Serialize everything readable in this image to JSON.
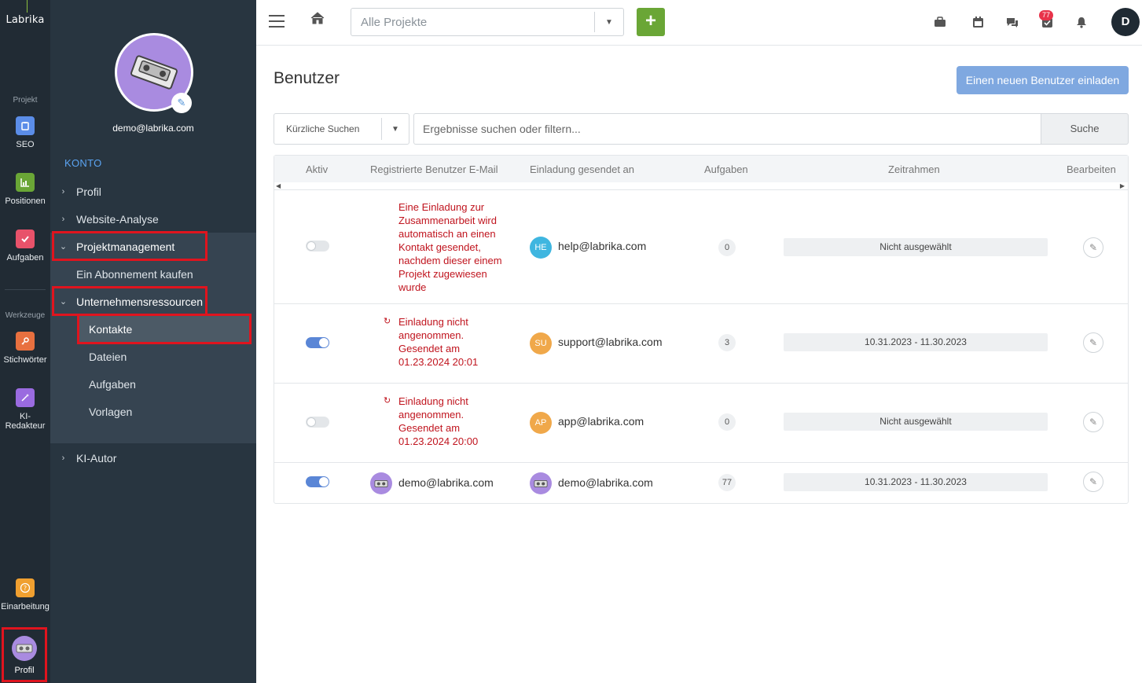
{
  "rail": {
    "logo": "Labrika",
    "section_project": "Projekt",
    "section_tools": "Werkzeuge",
    "items": [
      {
        "label": "SEO",
        "icon": "clipboard-icon",
        "color": "#5b8de8"
      },
      {
        "label": "Positionen",
        "icon": "chart-icon",
        "color": "#6aa636"
      },
      {
        "label": "Aufgaben",
        "icon": "check-icon",
        "color": "#e8526a"
      },
      {
        "label": "Stichwörter",
        "icon": "key-icon",
        "color": "#e8703f"
      },
      {
        "label1": "KI-",
        "label2": "Redakteur",
        "icon": "magic-wand-icon",
        "color": "#9a6be0"
      },
      {
        "label": "Einarbeitung",
        "icon": "help-icon",
        "color": "#f0a030"
      }
    ],
    "profile_label": "Profil"
  },
  "sidebar": {
    "email": "demo@labrika.com",
    "section": "KONTO",
    "nav": {
      "profil": "Profil",
      "website_analyse": "Website-Analyse",
      "projektmanagement": "Projektmanagement",
      "abonnement": "Ein Abonnement kaufen",
      "unternehmensressourcen": "Unternehmensressourcen",
      "kontakte": "Kontakte",
      "dateien": "Dateien",
      "aufgaben": "Aufgaben",
      "vorlagen": "Vorlagen",
      "ki_autor": "KI-Autor"
    }
  },
  "topbar": {
    "project_select": "Alle Projekte",
    "plus": "+",
    "badge_count": "77",
    "user_initial": "D"
  },
  "main": {
    "title": "Benutzer",
    "invite_button": "Einen neuen Benutzer einladen",
    "recent_searches": "Kürzliche Suchen",
    "search_placeholder": "Ergebnisse suchen oder filtern...",
    "search_button": "Suche",
    "columns": [
      "Aktiv",
      "Registrierte Benutzer E-Mail",
      "Einladung gesendet an",
      "Aufgaben",
      "Zeitrahmen",
      "Bearbeiten"
    ],
    "rows": [
      {
        "active": false,
        "registered_lines": [
          "Eine Einladung zur",
          "Zusammenarbeit wird",
          "automatisch an einen",
          "Kontakt gesendet,",
          "nachdem dieser einem",
          "Projekt zugewiesen",
          "wurde"
        ],
        "invite_initials": "HE",
        "invite_color": "#3fb6e0",
        "invite_email": "help@labrika.com",
        "tasks": "0",
        "period": "Nicht ausgewählt"
      },
      {
        "active": true,
        "registered_lines": [
          "Einladung nicht",
          "angenommen.",
          "Gesendet am",
          "01.23.2024 20:01"
        ],
        "invite_initials": "SU",
        "invite_color": "#f0a84a",
        "invite_email": "support@labrika.com",
        "tasks": "3",
        "period": "10.31.2023 - 11.30.2023"
      },
      {
        "active": false,
        "registered_lines": [
          "Einladung nicht",
          "angenommen.",
          "Gesendet am",
          "01.23.2024 20:00"
        ],
        "invite_initials": "AP",
        "invite_color": "#f0a84a",
        "invite_email": "app@labrika.com",
        "tasks": "0",
        "period": "Nicht ausgewählt"
      },
      {
        "active": true,
        "registered_email": "demo@labrika.com",
        "invite_email": "demo@labrika.com",
        "tasks": "77",
        "period": "10.31.2023 - 11.30.2023"
      }
    ]
  },
  "colors": {
    "highlight": "#e0141e",
    "accent_blue": "#5ba4f2",
    "green": "#6aa636",
    "error_red": "#c0141e"
  }
}
